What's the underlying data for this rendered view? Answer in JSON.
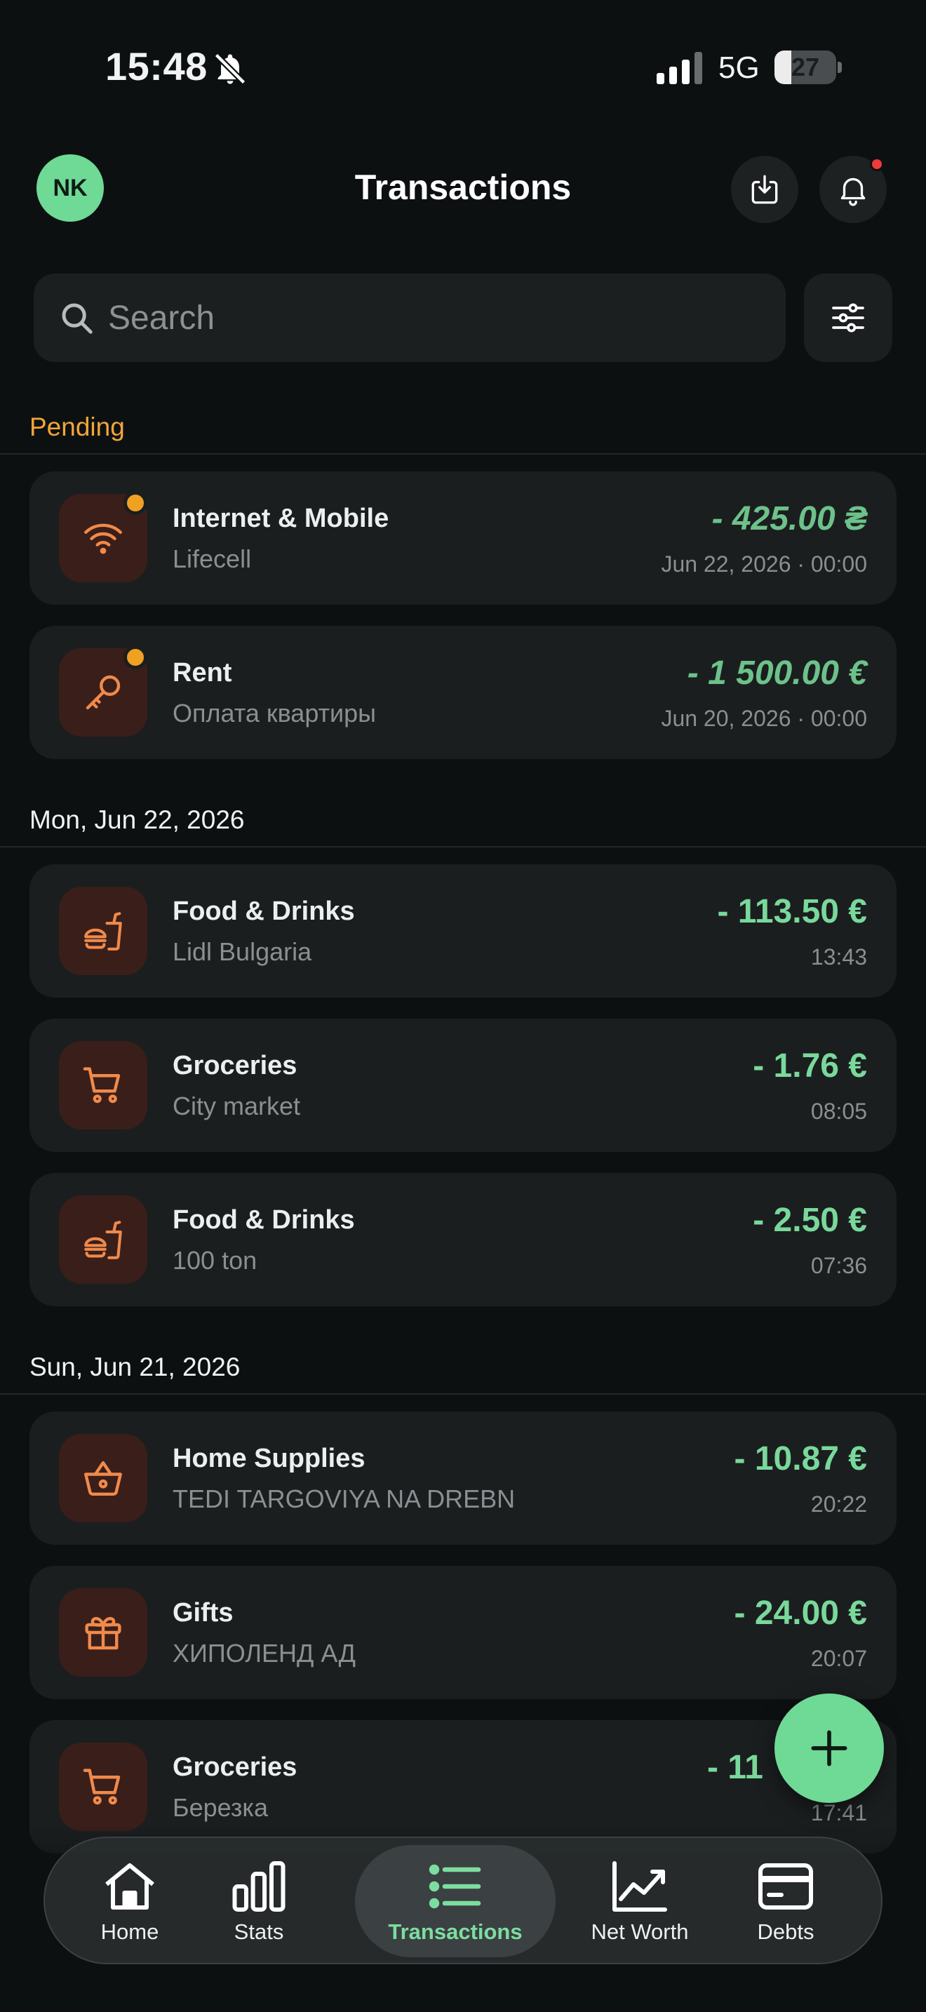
{
  "status_bar": {
    "time": "15:48",
    "network": "5G",
    "battery": "27",
    "battery_level": 0.27
  },
  "header": {
    "avatar_initials": "NK",
    "title": "Transactions"
  },
  "search": {
    "placeholder": "Search"
  },
  "sections": [
    {
      "label": "Pending",
      "transactions": [
        {
          "icon": "wifi-icon",
          "title": "Internet & Mobile",
          "subtitle": "Lifecell",
          "amount": "- 425.00 ₴",
          "time": "Jun 22, 2026 · 00:00",
          "pending": true
        },
        {
          "icon": "key-icon",
          "title": "Rent",
          "subtitle": "Оплата квартиры",
          "amount": "- 1 500.00 €",
          "time": "Jun 20, 2026 · 00:00",
          "pending": true
        }
      ]
    },
    {
      "label": "Mon, Jun 22, 2026",
      "transactions": [
        {
          "icon": "fast-food-icon",
          "title": "Food & Drinks",
          "subtitle": "Lidl Bulgaria",
          "amount": "- 113.50 €",
          "time": "13:43"
        },
        {
          "icon": "shopping-cart-icon",
          "title": "Groceries",
          "subtitle": "City market",
          "amount": "- 1.76 €",
          "time": "08:05"
        },
        {
          "icon": "fast-food-icon",
          "title": "Food & Drinks",
          "subtitle": "100 ton",
          "amount": "- 2.50 €",
          "time": "07:36"
        }
      ]
    },
    {
      "label": "Sun, Jun 21, 2026",
      "transactions": [
        {
          "icon": "basket-icon",
          "title": "Home Supplies",
          "subtitle": "TEDI TARGOVIYA NA DREBN",
          "amount": "- 10.87 €",
          "time": "20:22"
        },
        {
          "icon": "gift-icon",
          "title": "Gifts",
          "subtitle": "ХИПОЛЕНД АД",
          "amount": "- 24.00 €",
          "time": "20:07"
        },
        {
          "icon": "shopping-cart-icon",
          "title": "Groceries",
          "subtitle": "Березка",
          "amount": "- 11",
          "time": "17:41"
        }
      ]
    }
  ],
  "nav": {
    "items": [
      {
        "label": "Home",
        "icon": "home-icon"
      },
      {
        "label": "Stats",
        "icon": "bar-chart-icon"
      },
      {
        "label": "Transactions",
        "icon": "list-icon",
        "active": true
      },
      {
        "label": "Net Worth",
        "icon": "trend-icon"
      },
      {
        "label": "Debts",
        "icon": "credit-card-icon"
      }
    ]
  },
  "colors": {
    "background": "#0d1011",
    "card": "#1b1e1f",
    "accent_green": "#6fd996",
    "amount_green": "#79d89b",
    "pending_orange": "#f0a63a",
    "category_icon": "#f08a4b",
    "category_bg": "#3a1e1a",
    "notification_red": "#ef3a3a"
  }
}
